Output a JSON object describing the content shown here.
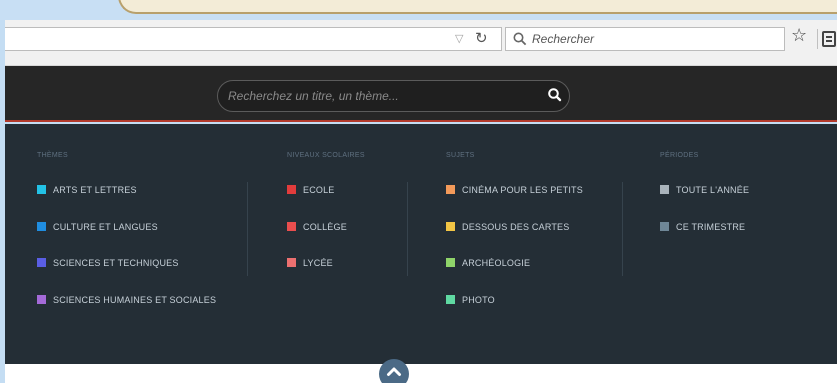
{
  "browser": {
    "url_reload_icon": "reload-icon",
    "search_placeholder": "Rechercher"
  },
  "site": {
    "search_placeholder": "Recherchez un titre, un thème..."
  },
  "menu": {
    "columns": [
      {
        "title": "THÈMES",
        "items": [
          {
            "label": "ARTS ET LETTRES",
            "color": "#23c2e6"
          },
          {
            "label": "CULTURE ET LANGUES",
            "color": "#1f8de0"
          },
          {
            "label": "SCIENCES ET TECHNIQUES",
            "color": "#5a5ee4"
          },
          {
            "label": "SCIENCES HUMAINES ET SOCIALES",
            "color": "#a46ad8"
          }
        ]
      },
      {
        "title": "NIVEAUX SCOLAIRES",
        "items": [
          {
            "label": "ECOLE",
            "color": "#e23c3c"
          },
          {
            "label": "COLLÈGE",
            "color": "#ea4e4e"
          },
          {
            "label": "LYCÉE",
            "color": "#ec7070"
          }
        ]
      },
      {
        "title": "SUJETS",
        "items": [
          {
            "label": "CINÉMA POUR LES PETITS",
            "color": "#f39a5a"
          },
          {
            "label": "DESSOUS DES CARTES",
            "color": "#f2c545"
          },
          {
            "label": "ARCHÉOLOGIE",
            "color": "#8fd46a"
          },
          {
            "label": "PHOTO",
            "color": "#5fd9a2"
          }
        ]
      },
      {
        "title": "PÉRIODES",
        "items": [
          {
            "label": "TOUTE L'ANNÉE",
            "color": "#a9b3bb"
          },
          {
            "label": "CE TRIMESTRE",
            "color": "#6f8797"
          }
        ]
      }
    ]
  },
  "colors": {
    "accent_rule": "#b23a2c",
    "menu_bg": "#242e36",
    "collapse_button": "#4b6a86"
  }
}
